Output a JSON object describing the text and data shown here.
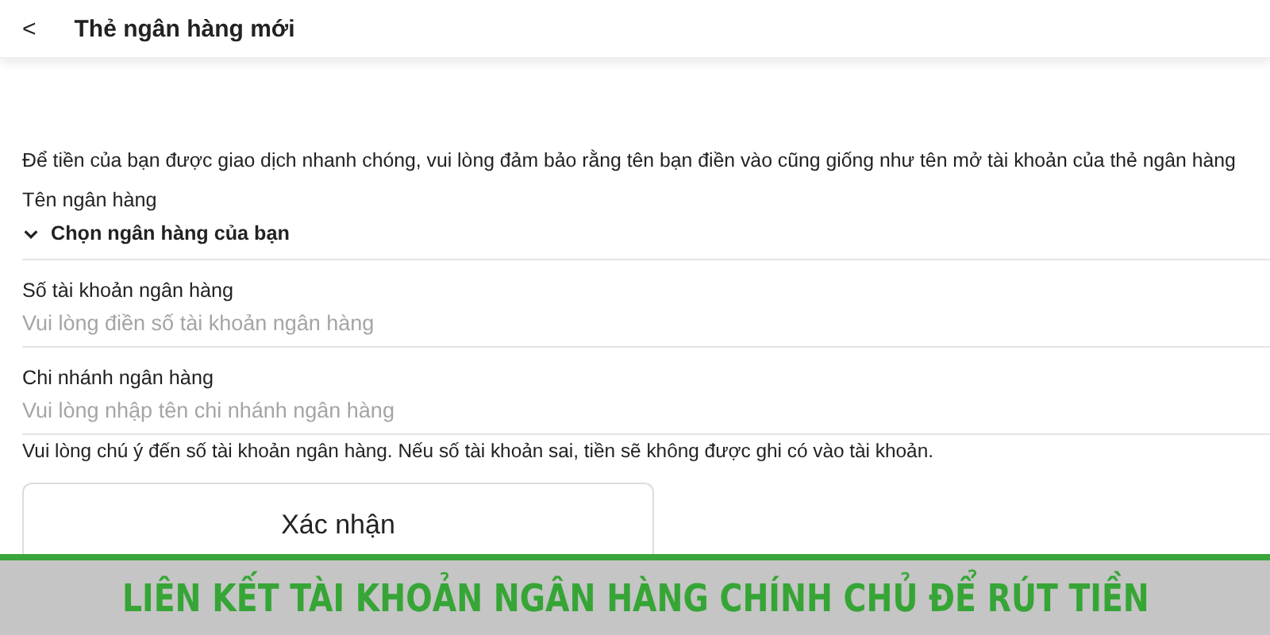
{
  "header": {
    "back": "<",
    "title": "Thẻ ngân hàng mới"
  },
  "notice": "Để tiền của bạn được giao dịch nhanh chóng, vui lòng đảm bảo rằng tên bạn điền vào cũng giống như tên mở tài khoản của thẻ ngân hàng",
  "bank_select": {
    "label": "Tên ngân hàng",
    "value": "Chọn ngân hàng của bạn",
    "expanded": false
  },
  "fields": [
    {
      "label": "Số tài khoản ngân hàng",
      "placeholder": "Vui lòng điền số tài khoản ngân hàng"
    },
    {
      "label": "Chi nhánh ngân hàng",
      "placeholder": "Vui lòng nhập tên chi nhánh ngân hàng"
    }
  ],
  "warning": "Vui lòng chú ý đến số tài khoản ngân hàng. Nếu số tài khoản sai, tiền sẽ không được ghi có vào tài khoản.",
  "confirm_button": "Xác nhận",
  "banner": "LIÊN KẾT TÀI KHOẢN NGÂN HÀNG CHÍNH CHỦ ĐỂ RÚT TIỀN"
}
